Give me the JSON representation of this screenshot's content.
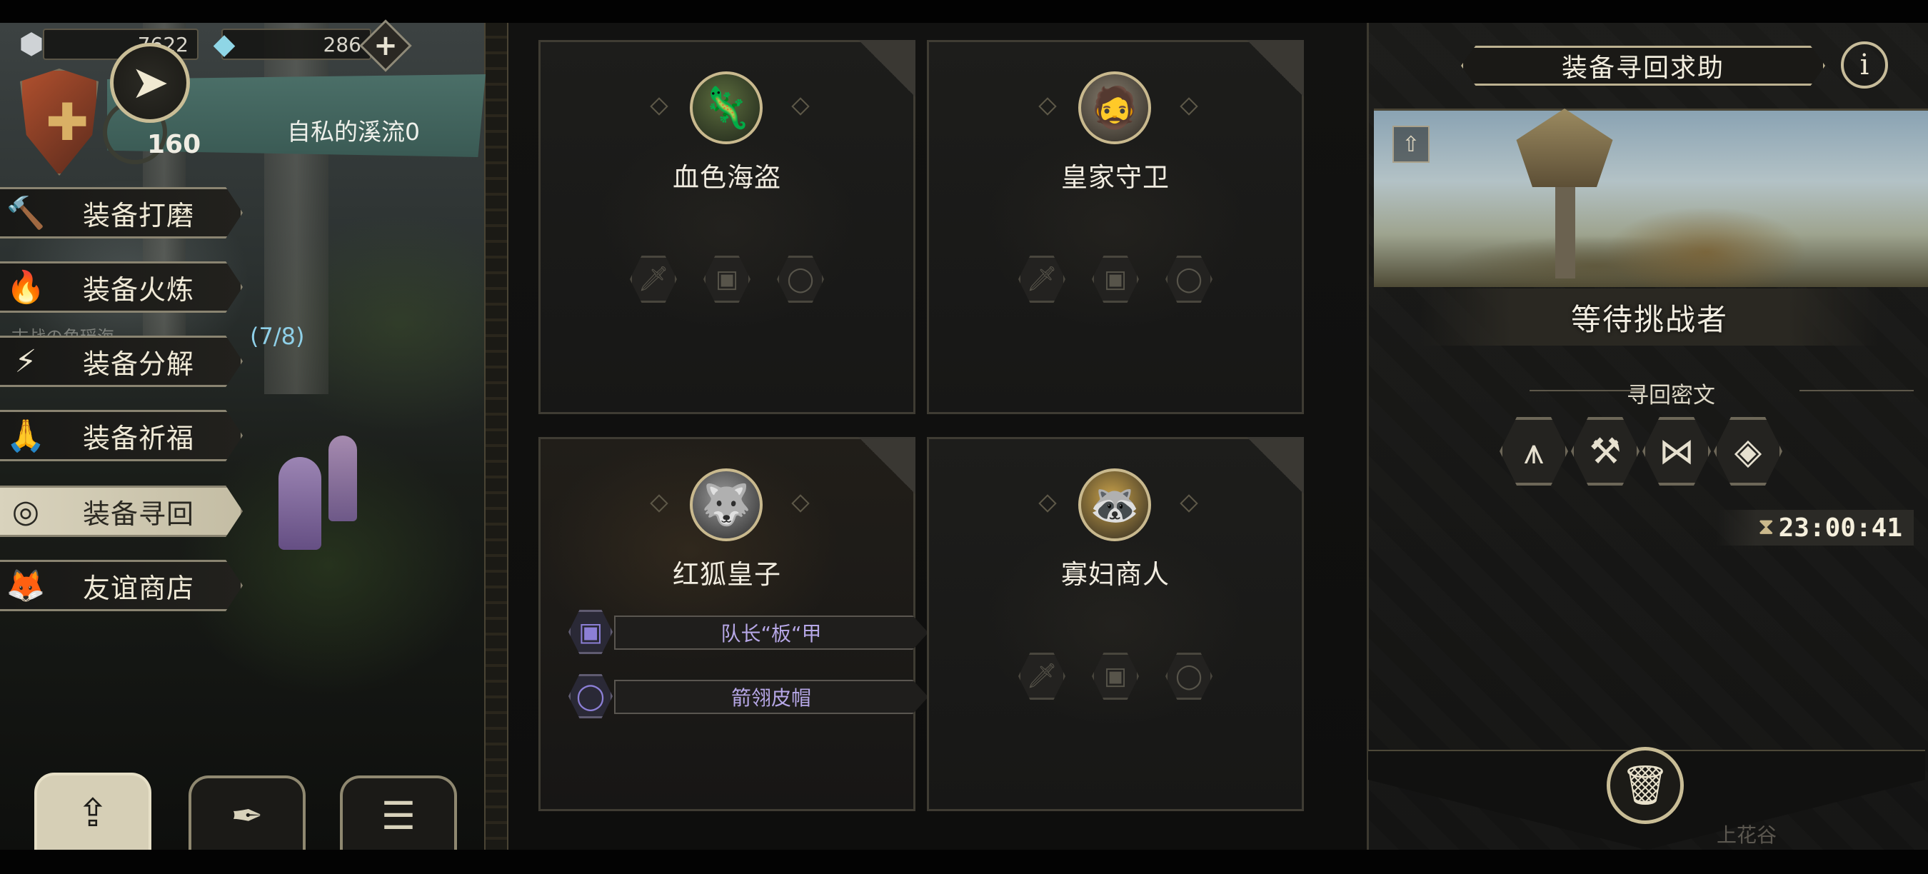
{
  "resources": {
    "stone_count": "7622",
    "gem_count": "286",
    "stone_icon": "stone-icon",
    "gem_icon": "crystal-icon",
    "plus_label": "+"
  },
  "player": {
    "level": "160",
    "region": "自私的溪流0"
  },
  "menu": {
    "items": [
      {
        "label": "装备打磨",
        "icon": "hammer-icon",
        "glyph": "🔨"
      },
      {
        "label": "装备火炼",
        "icon": "flame-icon",
        "glyph": "🔥"
      },
      {
        "label": "装备分解",
        "icon": "break-icon",
        "glyph": "⚡"
      },
      {
        "label": "装备祈福",
        "icon": "pray-icon",
        "glyph": "🙏"
      },
      {
        "label": "装备寻回",
        "icon": "target-icon",
        "glyph": "◎"
      },
      {
        "label": "友谊商店",
        "icon": "fox-icon",
        "glyph": "🦊"
      }
    ],
    "active_index": 4,
    "progress": "(7/8)",
    "faded_text": "古战の角瑶海"
  },
  "bottom_tabs": [
    {
      "icon": "upload-icon",
      "glyph": "⇪"
    },
    {
      "icon": "feather-icon",
      "glyph": "✒"
    },
    {
      "icon": "list-icon",
      "glyph": "☰"
    }
  ],
  "cards": [
    {
      "name": "血色海盗",
      "portrait": "lizard-pirate-portrait",
      "glyph": "🦎"
    },
    {
      "name": "皇家守卫",
      "portrait": "royal-guard-portrait",
      "glyph": "🧔"
    },
    {
      "name": "红狐皇子",
      "portrait": "red-fox-prince-portrait",
      "glyph": "🐺"
    },
    {
      "name": "寡妇商人",
      "portrait": "widow-merchant-portrait",
      "glyph": "🦝"
    }
  ],
  "slots": {
    "weapon": "🗡",
    "armor": "▣",
    "ring": "◯"
  },
  "equipment": [
    {
      "label": "队长“板“甲",
      "icon": "armor-icon",
      "glyph": "▣"
    },
    {
      "label": "箭翎皮帽",
      "icon": "ring-icon",
      "glyph": "◯"
    }
  ],
  "panel": {
    "title": "装备寻回求助",
    "info": "i",
    "status": "等待挑战者",
    "rune_title": "寻回密文",
    "runes": [
      "⩚",
      "⚒",
      "⋈",
      "◈"
    ],
    "timer": "23:00:41",
    "upload_glyph": "⇧",
    "trash_glyph": "🗑",
    "footer": "上花谷"
  },
  "colors": {
    "accent_gold": "#c9bd96",
    "equip_purple": "#b6a7e6",
    "progress_cyan": "#8fd0e8"
  }
}
